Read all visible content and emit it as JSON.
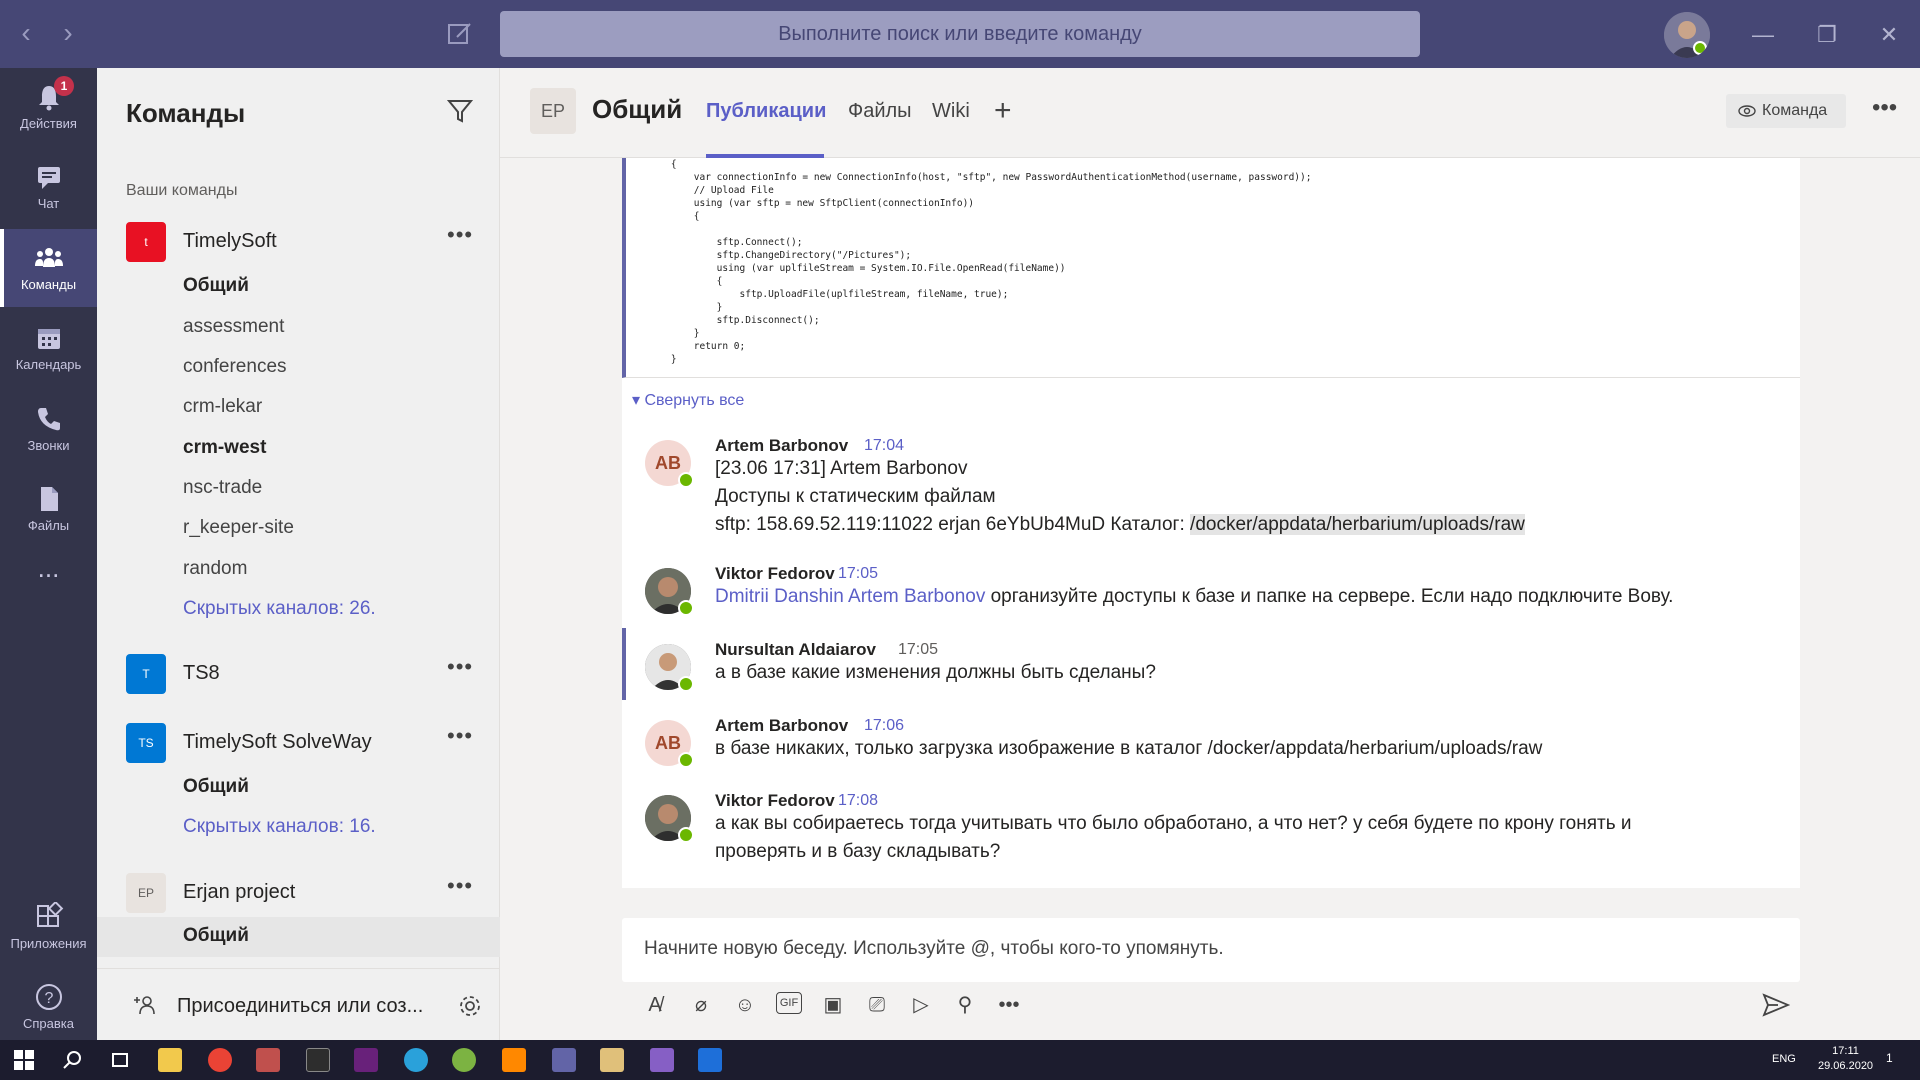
{
  "search": {
    "placeholder": "Выполните поиск или введите команду"
  },
  "rail": {
    "items": [
      {
        "label": "Действия",
        "badge": "1"
      },
      {
        "label": "Чат"
      },
      {
        "label": "Команды"
      },
      {
        "label": "Календарь"
      },
      {
        "label": "Звонки"
      },
      {
        "label": "Файлы"
      },
      {
        "label": "..."
      },
      {
        "label": "Приложения"
      },
      {
        "label": "Справка"
      }
    ]
  },
  "teams_panel": {
    "title": "Команды",
    "section": "Ваши команды",
    "teams": [
      {
        "logo": "t",
        "name": "TimelySoft",
        "color": "#e81123",
        "channels": [
          "Общий",
          "assessment",
          "conferences",
          "crm-lekar",
          "crm-west",
          "nsc-trade",
          "r_keeper-site",
          "random"
        ],
        "hidden": "Скрытых каналов: 26."
      },
      {
        "logo": "T",
        "name": "TS8",
        "color": "#0078d4"
      },
      {
        "logo": "TS",
        "name": "TimelySoft SolveWay",
        "color": "#0078d4",
        "channels": [
          "Общий"
        ],
        "hidden": "Скрытых каналов: 16."
      },
      {
        "logo": "EP",
        "name": "Erjan project",
        "color": "#e8e3df",
        "channels": [
          "Общий"
        ]
      }
    ],
    "join": "Присоединиться или соз..."
  },
  "channel": {
    "logo": "EP",
    "title": "Общий",
    "tabs": [
      "Публикации",
      "Файлы",
      "Wiki"
    ],
    "team_button": "Команда"
  },
  "code_lines": [
    "    {",
    "        var connectionInfo = new ConnectionInfo(host, \"sftp\", new PasswordAuthenticationMethod(username, password));",
    "        // Upload File",
    "        using (var sftp = new SftpClient(connectionInfo))",
    "        {",
    "",
    "            sftp.Connect();",
    "            sftp.ChangeDirectory(\"/Pictures\");",
    "            using (var uplfileStream = System.IO.File.OpenRead(fileName))",
    "            {",
    "                sftp.UploadFile(uplfileStream, fileName, true);",
    "            }",
    "            sftp.Disconnect();",
    "        }",
    "        return 0;",
    "    }"
  ],
  "collapse_all": "Свернуть все",
  "messages": [
    {
      "author": "Artem Barbonov",
      "time": "17:04",
      "initials": "AB",
      "lines": [
        "[23.06 17:31] Artem Barbonov",
        "Доступы к статическим файлам"
      ],
      "sftp_prefix": "sftp: 158.69.52.119:11022  erjan  6eYbUb4MuD  Каталог: ",
      "sftp_path": "/docker/appdata/herbarium/uploads/raw"
    },
    {
      "author": "Viktor Fedorov",
      "time": "17:05",
      "mention": "Dmitrii Danshin Artem Barbonov",
      "text": " организуйте доступы к базе и папке на сервере. Если надо подключите Вову."
    },
    {
      "author": "Nursultan Aldaiarov",
      "time": "17:05",
      "text": "а в базе какие изменения должны быть сделаны?"
    },
    {
      "author": "Artem Barbonov",
      "time": "17:06",
      "initials": "AB",
      "text": "в базе никаких, только загрузка изображение в каталог /docker/appdata/herbarium/uploads/raw"
    },
    {
      "author": "Viktor Fedorov",
      "time": "17:08",
      "line1": "а как вы собираетесь тогда учитывать что было обработано, а что нет? у себя будете по крону гонять и",
      "line2": "проверять и в базу складывать?"
    }
  ],
  "composer": {
    "placeholder": "Начните новую беседу. Используйте @, чтобы кого-то упомянуть."
  },
  "taskbar": {
    "lang": "ENG",
    "time": "17:11",
    "date": "29.06.2020",
    "notif": "1"
  }
}
